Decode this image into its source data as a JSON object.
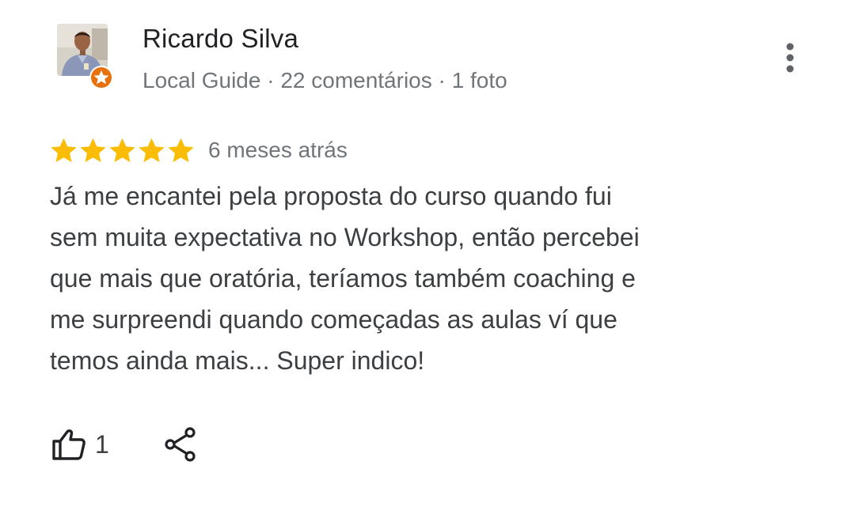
{
  "author": {
    "name": "Ricardo Silva",
    "meta": "Local Guide · 22 comentários · 1 foto"
  },
  "review": {
    "rating": 5,
    "max_rating": 5,
    "date": "6 meses atrás",
    "text_lines": [
      "Já me encantei pela proposta do curso quando fui",
      "sem muita expectativa no Workshop, então percebei",
      "que mais que oratória, teríamos também coaching e",
      "me surpreendi quando começadas as aulas ví que",
      "temos ainda mais... Super indico!"
    ]
  },
  "actions": {
    "like_count": "1"
  },
  "colors": {
    "star": "#fbbc04",
    "badge": "#e8710a",
    "secondary_text": "#70757a",
    "body_text": "#3c4043"
  },
  "icons": {
    "avatar": "avatar",
    "badge": "local-guide-badge-icon",
    "menu": "more-vert-icon",
    "like": "thumb-up-icon",
    "share": "share-icon"
  }
}
